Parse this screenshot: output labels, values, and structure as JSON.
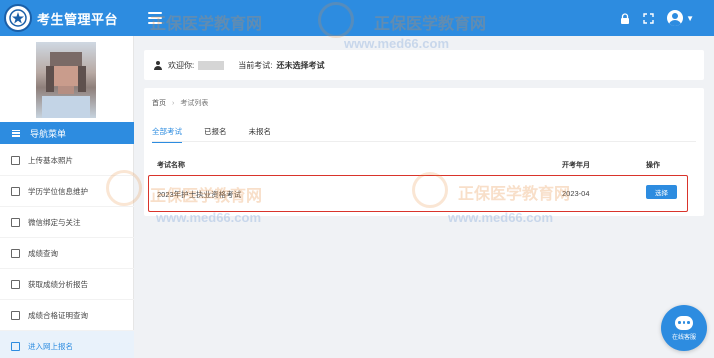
{
  "header": {
    "app_title": "考生管理平台",
    "icons": [
      "lock-icon",
      "fullscreen-icon",
      "user-avatar-icon",
      "caret-down-icon"
    ]
  },
  "sidebar": {
    "nav_title": "导航菜单",
    "items": [
      {
        "label": "上传基本照片",
        "icon": "image-icon"
      },
      {
        "label": "学历学位信息维护",
        "icon": "id-card-icon"
      },
      {
        "label": "微信绑定与关注",
        "icon": "wechat-icon"
      },
      {
        "label": "成绩查询",
        "icon": "document-icon"
      },
      {
        "label": "获取成绩分析报告",
        "icon": "report-icon"
      },
      {
        "label": "成绩合格证明查询",
        "icon": "certificate-icon"
      },
      {
        "label": "进入网上报名",
        "icon": "send-icon",
        "active": true
      }
    ]
  },
  "welcome": {
    "greeting": "欢迎你:",
    "current_exam_label": "当前考试:",
    "current_exam_value": "还未选择考试"
  },
  "exam_list": {
    "breadcrumb": {
      "home": "首页",
      "current": "考试列表"
    },
    "tabs": [
      {
        "label": "全部考试",
        "active": true
      },
      {
        "label": "已报名"
      },
      {
        "label": "未报名"
      }
    ],
    "columns": {
      "name": "考试名称",
      "year_month": "开考年月",
      "action": "操作"
    },
    "rows": [
      {
        "name": "2023年护士执业资格考试",
        "year_month": "2023-04",
        "action": "选择"
      }
    ]
  },
  "watermark": {
    "brand": "正保医学教育网",
    "url": "www.med66.com"
  },
  "chat": {
    "label": "在线客服"
  },
  "colors": {
    "primary": "#2d8ce0",
    "highlight_border": "#d9342b",
    "watermark": "#e68c3c"
  }
}
